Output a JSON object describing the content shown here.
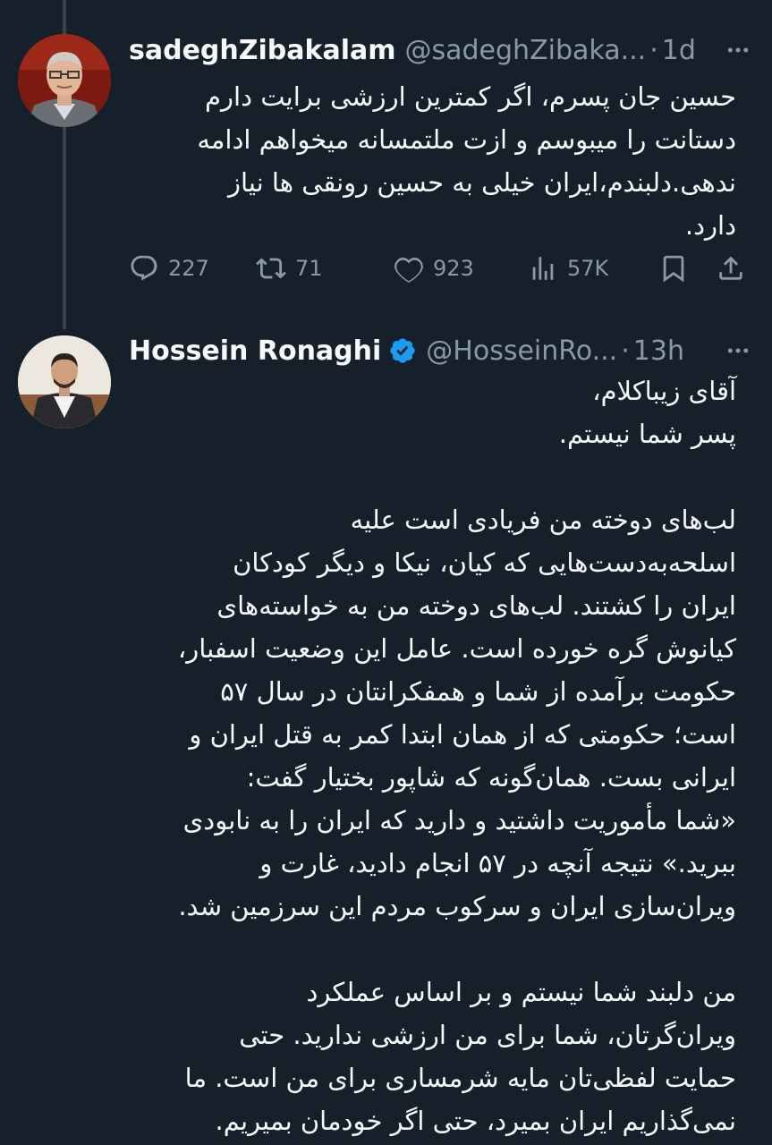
{
  "tweets": [
    {
      "display_name": "sadeghZibakalam",
      "handle": "@sadeghZibaka...",
      "separator": "·",
      "time": "1d",
      "verified": false,
      "text": "حسین جان پسرم، اگر کمترین ارزشی برایت دارم\nدستانت را میبوسم و ازت ملتمسانه میخواهم ادامه\nندهی.دلبندم،ایران خیلی به حسین رونقی ها  نیاز\nدارد.",
      "stats": {
        "replies": "227",
        "retweets": "71",
        "likes": "923",
        "views": "57K"
      }
    },
    {
      "display_name": "Hossein Ronaghi",
      "handle": "@HosseinRo...",
      "separator": "·",
      "time": "13h",
      "verified": true,
      "text": "آقای زیباکلام،\nپسر شما نیستم.\n\nلب‌های دوخته من فریادی است علیه\nاسلحه‌به‌دست‌هایی که کیان، نیکا و دیگر کودکان\nایران را کشتند. لب‌های دوخته من به خواسته‌های\nکیانوش گره خورده است. عامل این وضعیت اسفبار،\nحکومت برآمده از شما و همفکرانتان در سال ۵۷\nاست؛ حکومتی که از همان ابتدا کمر به قتل ایران و\nایرانی بست. همان‌گونه که شاپور بختیار گفت:\n«شما مأموریت داشتید و دارید که ایران را به نابودی\nببرید.» نتیجه آنچه در ۵۷ انجام دادید، غارت و\nویران‌سازی ایران و سرکوب مردم این سرزمین شد.\n\nمن دلبند شما نیستم و بر اساس عملکرد\nویران‌گرتان، شما برای من ارزشی ندارید. حتی\nحمایت لفظی‌تان مایه شرمساری برای من است. ما\nنمی‌گذاریم ایران بمیرد، حتی اگر خودمان بمیریم.\nدست از سر ایران بردارید."
    }
  ],
  "colors": {
    "background": "#15202b",
    "text_primary": "#f7f9f9",
    "text_secondary": "#8b98a5",
    "verified_badge": "#1d9bf0",
    "thread_line": "#38444d"
  },
  "icons": {
    "reply": "reply-icon",
    "retweet": "retweet-icon",
    "like": "heart-icon",
    "views": "views-chart-icon",
    "bookmark": "bookmark-icon",
    "share": "share-icon",
    "more": "more-dots-icon",
    "verified": "verified-badge-icon"
  }
}
